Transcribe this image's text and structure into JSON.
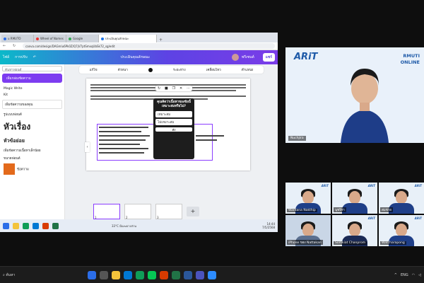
{
  "browser": {
    "tabs": [
      {
        "label": "u RMUTO",
        "color": "#2b6de8"
      },
      {
        "label": "Wheel of Names",
        "color": "#e33"
      },
      {
        "label": "Google",
        "color": "#34a853"
      },
      {
        "label": "ประเมินคุณลักษณะ",
        "color": "#1a73e8",
        "active": true
      }
    ],
    "url": "canva.com/design/DAGmlu6Pk0Z/Q7jV7ptSmxqUbSk72_sg/edit"
  },
  "canva": {
    "menu": [
      "ไฟล์",
      "การปรับ"
    ],
    "title": "ประเมินคุณลักษณะ",
    "share_label": "แชร์",
    "present_label": "พรีเซนต์",
    "toolbar": [
      "แก้ไข",
      "ตัวหนา",
      "ระยะห่าง",
      "เคลื่อนไหว",
      "ตำแหน่ง"
    ],
    "sidebar": {
      "heading": "Magic Write",
      "cta": "เพิ่มกล่องข้อความ",
      "search_placeholder": "ค้นหาฟอนต์",
      "rows": [
        "Kit",
        "เพิ่มข้อความของคุณ",
        "ขนาดฟอนต์"
      ],
      "big_text": "หัวเรื่อง",
      "mid_text": "หัวข้อย่อย",
      "small_text": "เพิ่มข้อความเนื้อหาเล็กน้อย",
      "section": "รูปแบบฟอนต์",
      "swatch_label": "ข้อความ"
    },
    "popup": {
      "question": "คุณคิดว่าเนื้อหาของข้อนี้เหมาะสมหรือไม่?",
      "options": [
        "เหมาะสม",
        "ไม่เหมาะสม"
      ],
      "go": "ส่ง"
    },
    "status": {
      "notes": "หมายเหตุ",
      "timer": "ระยะเวลา",
      "zoom": "28%",
      "page": "1 / 3"
    }
  },
  "windows_inner": {
    "weather": "33°C มีเมฆบางส่วน",
    "time": "14:44",
    "date": "7/5/2568"
  },
  "meeting": {
    "speaker": {
      "name": "Nuchjira",
      "logo": "ARiT",
      "brand_line1": "RMUTI",
      "brand_line2": "ONLINE"
    },
    "participants": [
      {
        "name": "Wantana Nakthip"
      },
      {
        "name": "นุชจิรา"
      },
      {
        "name": "สมชาย"
      },
      {
        "name": "iPhone ของ Nattakan"
      },
      {
        "name": "Somkiat Chanprom"
      },
      {
        "name": "Watcharapong"
      }
    ]
  },
  "taskbar": {
    "search": "ค้นหา",
    "lang": "ENG"
  },
  "colors": {
    "canva_purple": "#8b3dff",
    "speaker_bg": "#e9f1fa"
  }
}
